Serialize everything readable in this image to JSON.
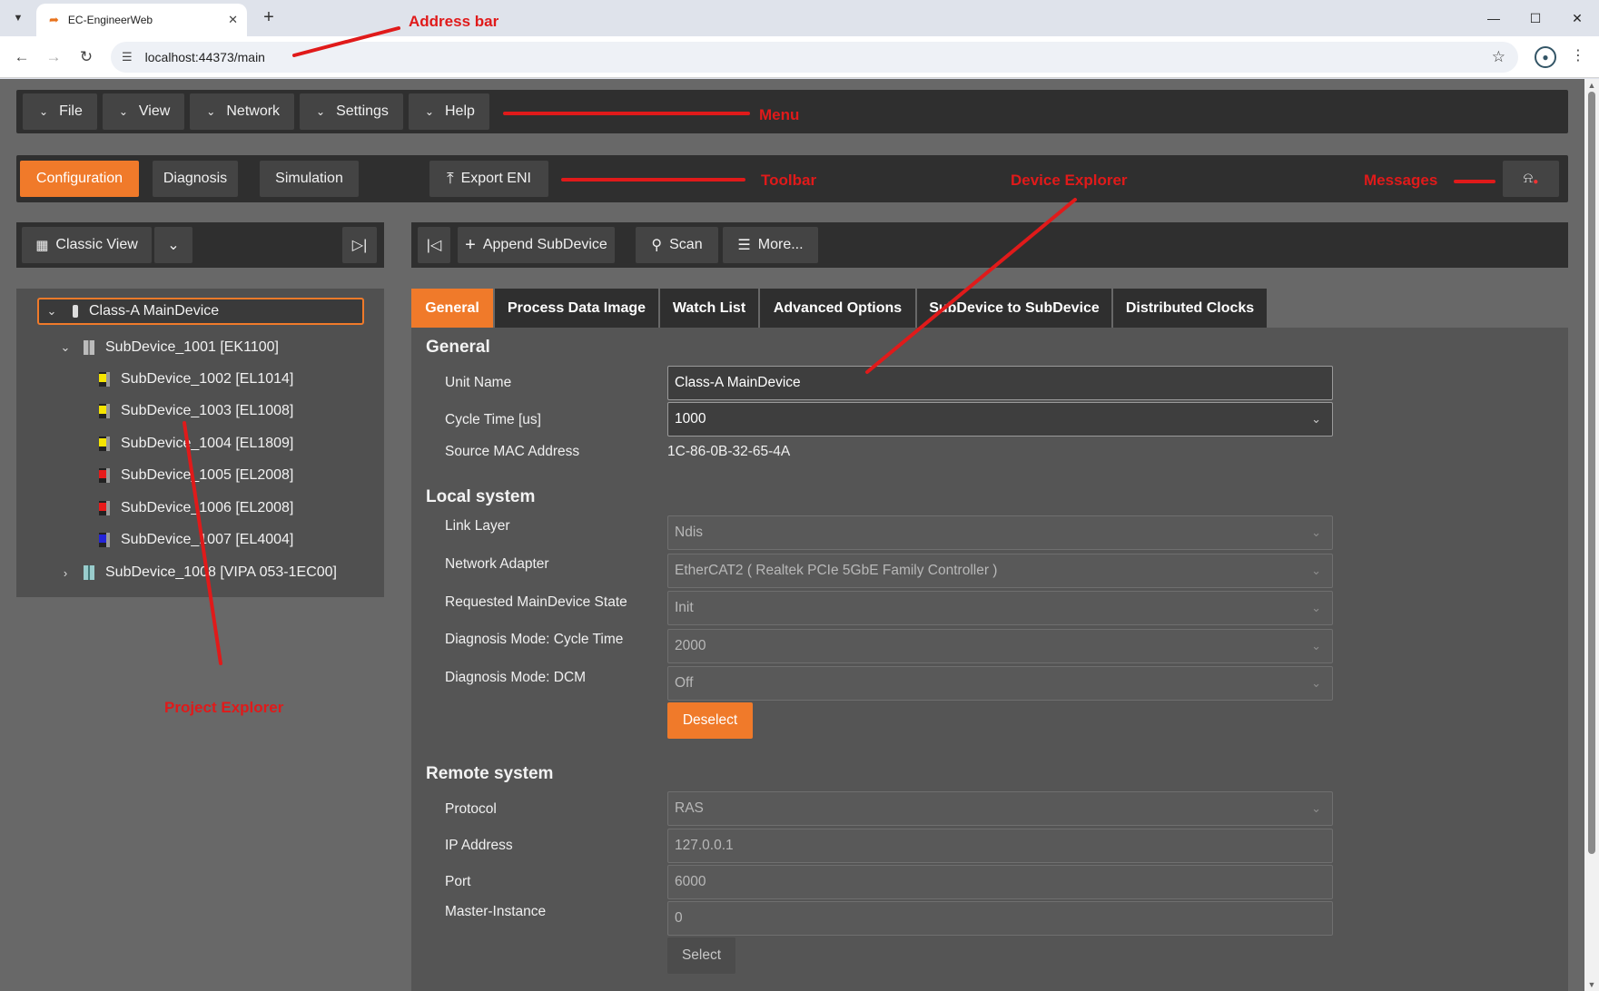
{
  "browser": {
    "tab_title": "EC-EngineerWeb",
    "url": "localhost:44373/main"
  },
  "menu": {
    "items": [
      {
        "label": "File"
      },
      {
        "label": "View"
      },
      {
        "label": "Network"
      },
      {
        "label": "Settings"
      },
      {
        "label": "Help"
      }
    ]
  },
  "toolbar": {
    "modes": [
      {
        "label": "Configuration",
        "active": true
      },
      {
        "label": "Diagnosis",
        "active": false
      },
      {
        "label": "Simulation",
        "active": false
      }
    ],
    "export_label": "Export ENI"
  },
  "project_explorer": {
    "view_label": "Classic View",
    "tree": [
      {
        "label": "Class-A MainDevice",
        "expanded": true,
        "selected": true
      },
      {
        "label": "SubDevice_1001 [EK1100]",
        "expanded": true
      },
      {
        "label": "SubDevice_1002 [EL1014]",
        "color": "#f5e400"
      },
      {
        "label": "SubDevice_1003 [EL1008]",
        "color": "#f5e400"
      },
      {
        "label": "SubDevice_1004 [EL1809]",
        "color": "#f5e400"
      },
      {
        "label": "SubDevice_1005 [EL2008]",
        "color": "#e81a1a"
      },
      {
        "label": "SubDevice_1006 [EL2008]",
        "color": "#e81a1a"
      },
      {
        "label": "SubDevice_1007 [EL4004]",
        "color": "#2424d8"
      },
      {
        "label": "SubDevice_1008 [VIPA 053-1EC00]",
        "expanded": false
      }
    ]
  },
  "device_explorer": {
    "actions": {
      "append": "Append SubDevice",
      "scan": "Scan",
      "more": "More..."
    },
    "tabs": [
      {
        "label": "General",
        "active": true
      },
      {
        "label": "Process Data Image"
      },
      {
        "label": "Watch List"
      },
      {
        "label": "Advanced Options"
      },
      {
        "label": "SubDevice to SubDevice"
      },
      {
        "label": "Distributed Clocks"
      }
    ],
    "general": {
      "title": "General",
      "unit_name_label": "Unit Name",
      "unit_name_value": "Class-A MainDevice",
      "cycle_time_label": "Cycle Time [us]",
      "cycle_time_value": "1000",
      "mac_label": "Source MAC Address",
      "mac_value": "1C-86-0B-32-65-4A"
    },
    "local_system": {
      "title": "Local system",
      "link_layer_label": "Link Layer",
      "link_layer_value": "Ndis",
      "adapter_label": "Network Adapter",
      "adapter_value": "EtherCAT2 ( Realtek PCIe 5GbE Family Controller )",
      "state_label": "Requested MainDevice State",
      "state_value": "Init",
      "diag_cycle_label": "Diagnosis Mode: Cycle Time",
      "diag_cycle_value": "2000",
      "diag_dcm_label": "Diagnosis Mode: DCM",
      "diag_dcm_value": "Off",
      "deselect_label": "Deselect"
    },
    "remote_system": {
      "title": "Remote system",
      "protocol_label": "Protocol",
      "protocol_value": "RAS",
      "ip_label": "IP Address",
      "ip_value": "127.0.0.1",
      "port_label": "Port",
      "port_value": "6000",
      "instance_label": "Master-Instance",
      "instance_value": "0",
      "select_label": "Select"
    }
  },
  "annotations": {
    "address_bar": "Address bar",
    "menu": "Menu",
    "toolbar": "Toolbar",
    "device_explorer": "Device Explorer",
    "messages": "Messages",
    "project_explorer": "Project Explorer"
  },
  "colors": {
    "accent": "#f07a2a",
    "annotation": "#e01a1a"
  }
}
